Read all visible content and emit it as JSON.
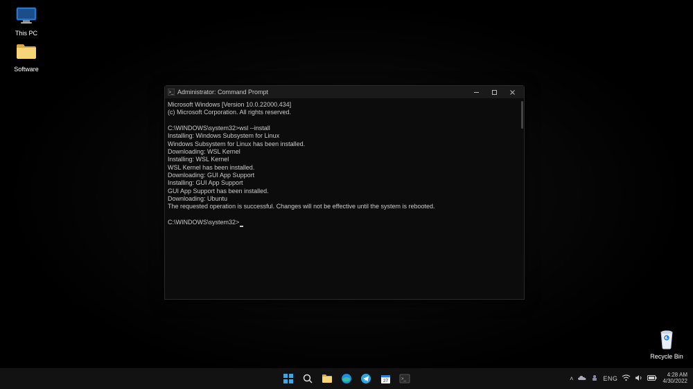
{
  "desktop": {
    "icons": [
      {
        "name": "this-pc",
        "label": "This PC"
      },
      {
        "name": "software",
        "label": "Software"
      },
      {
        "name": "recycle-bin",
        "label": "Recycle Bin"
      }
    ]
  },
  "window": {
    "title": "Administrator: Command Prompt",
    "lines": [
      "Microsoft Windows [Version 10.0.22000.434]",
      "(c) Microsoft Corporation. All rights reserved.",
      "",
      "C:\\WINDOWS\\system32>wsl --install",
      "Installing: Windows Subsystem for Linux",
      "Windows Subsystem for Linux has been installed.",
      "Downloading: WSL Kernel",
      "Installing: WSL Kernel",
      "WSL Kernel has been installed.",
      "Downloading: GUI App Support",
      "Installing: GUI App Support",
      "GUI App Support has been installed.",
      "Downloading: Ubuntu",
      "The requested operation is successful. Changes will not be effective until the system is rebooted.",
      "",
      "C:\\WINDOWS\\system32>"
    ]
  },
  "taskbar": {
    "items": [
      "start",
      "search",
      "file-explorer",
      "edge",
      "telegram",
      "calendar",
      "terminal"
    ],
    "tray": {
      "chevron": "˄",
      "onedrive": true,
      "teams": true,
      "language": "ENG",
      "wifi": true,
      "volume": true,
      "battery": true
    },
    "clock": {
      "time": "4:28 AM",
      "date": "4/30/2022"
    }
  }
}
